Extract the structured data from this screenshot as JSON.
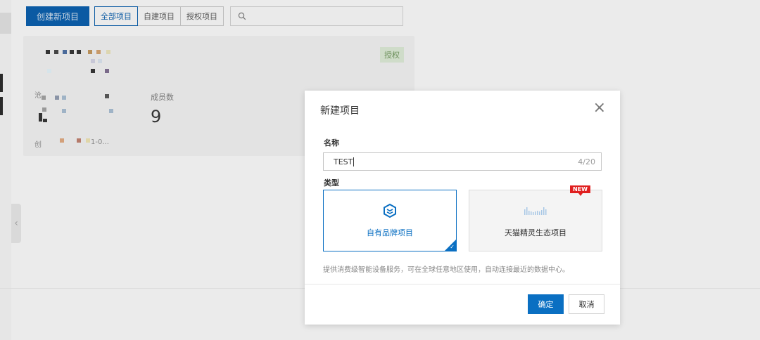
{
  "toolbar": {
    "create_label": "创建新项目",
    "filters": [
      "全部项目",
      "自建项目",
      "授权项目"
    ],
    "active_filter": "全部项目",
    "search_placeholder": ""
  },
  "card": {
    "badge": "授权",
    "members_label": "成员数",
    "members_value": "9",
    "partial_labels": [
      "沧",
      "创",
      "1-0..."
    ]
  },
  "modal": {
    "title": "新建项目",
    "name_label": "名称",
    "name_value": "TEST",
    "name_count": "4/20",
    "type_label": "类型",
    "types": [
      {
        "label": "自有品牌项目",
        "icon": "cube-hex-icon",
        "selected": true
      },
      {
        "label": "天猫精灵生态项目",
        "icon": "tmall-genie-icon",
        "selected": false,
        "badge": "NEW"
      }
    ],
    "description": "提供消费级智能设备服务，可在全球任意地区使用，自动连接最近的数据中心。",
    "ok_label": "确定",
    "cancel_label": "取消"
  },
  "colors": {
    "primary": "#0a6fc2",
    "new_badge": "#e02020",
    "auth_badge_bg": "#cfdcc9"
  }
}
